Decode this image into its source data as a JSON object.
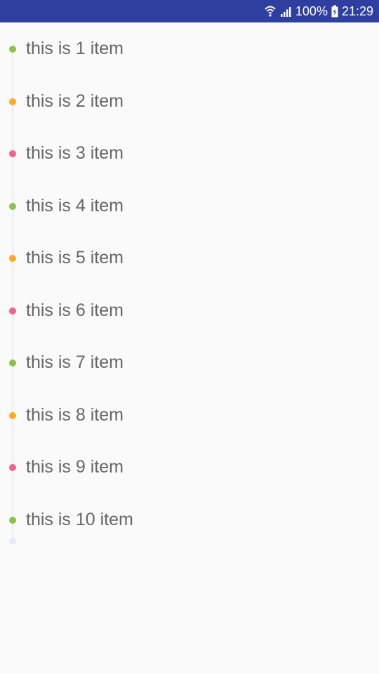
{
  "status_bar": {
    "battery": "100%",
    "time": "21:29",
    "background": "#2f3f9f"
  },
  "timeline": {
    "items": [
      {
        "label": "this is 1 item",
        "dot_color": "#8bc34a"
      },
      {
        "label": "this is 2 item",
        "dot_color": "#ffa726"
      },
      {
        "label": "this is 3 item",
        "dot_color": "#f06292"
      },
      {
        "label": "this is 4 item",
        "dot_color": "#8bc34a"
      },
      {
        "label": "this is 5 item",
        "dot_color": "#ffa726"
      },
      {
        "label": "this is 6 item",
        "dot_color": "#f06292"
      },
      {
        "label": "this is 7 item",
        "dot_color": "#8bc34a"
      },
      {
        "label": "this is 8 item",
        "dot_color": "#ffa726"
      },
      {
        "label": "this is 9 item",
        "dot_color": "#f06292"
      },
      {
        "label": "this is 10 item",
        "dot_color": "#8bc34a"
      }
    ],
    "end_dot_color": "#e9ebf4"
  }
}
